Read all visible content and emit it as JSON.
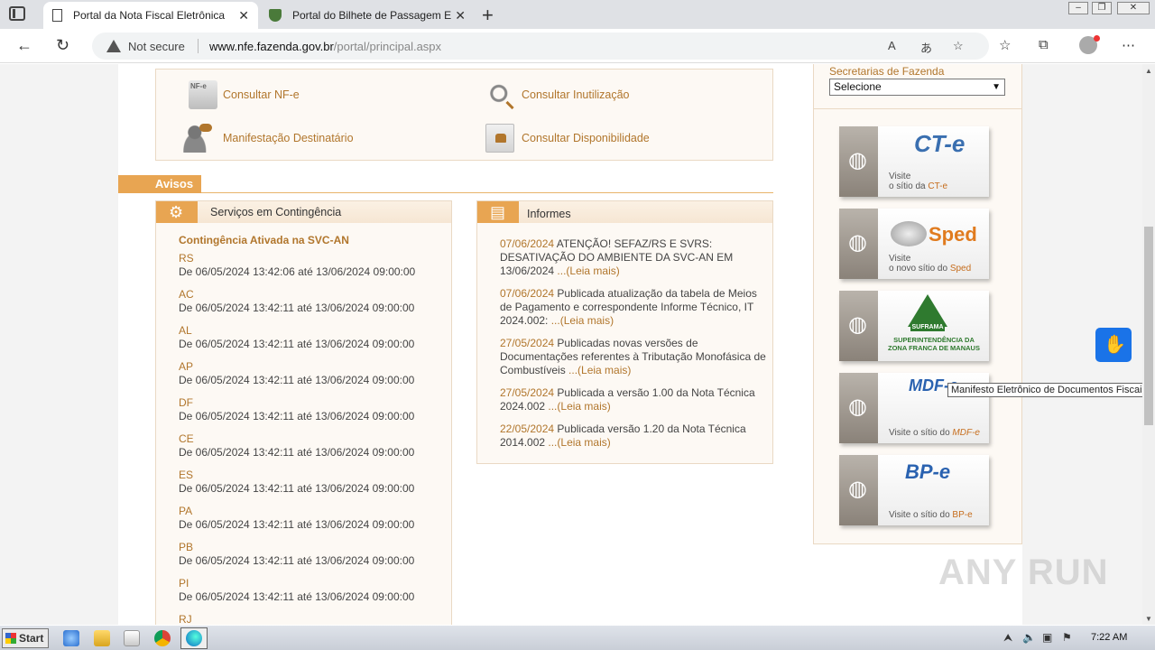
{
  "browser": {
    "tabs": [
      {
        "title": "Portal da Nota Fiscal Eletrônica",
        "active": true
      },
      {
        "title": "Portal do Bilhete de Passagem Ele",
        "active": false
      }
    ],
    "close_glyph": "✕",
    "new_tab_glyph": "+",
    "security": "Not secure",
    "url_host": "www.nfe.fazenda.gov.br",
    "url_path": "/portal/principal.aspx"
  },
  "services": {
    "consultar_nfe": "Consultar NF-e",
    "manifestacao": "Manifestação Destinatário",
    "consultar_inutilizacao": "Consultar Inutilização",
    "consultar_disponibilidade": "Consultar Disponibilidade"
  },
  "avisos": {
    "label": "Avisos"
  },
  "contingencia": {
    "panel_title": "Serviços em Contingência",
    "title": "Contingência Ativada na SVC-AN",
    "states": [
      {
        "code": "RS",
        "period": "De 06/05/2024 13:42:06 até 13/06/2024 09:00:00"
      },
      {
        "code": "AC",
        "period": "De 06/05/2024 13:42:11 até 13/06/2024 09:00:00"
      },
      {
        "code": "AL",
        "period": "De 06/05/2024 13:42:11 até 13/06/2024 09:00:00"
      },
      {
        "code": "AP",
        "period": "De 06/05/2024 13:42:11 até 13/06/2024 09:00:00"
      },
      {
        "code": "DF",
        "period": "De 06/05/2024 13:42:11 até 13/06/2024 09:00:00"
      },
      {
        "code": "CE",
        "period": "De 06/05/2024 13:42:11 até 13/06/2024 09:00:00"
      },
      {
        "code": "ES",
        "period": "De 06/05/2024 13:42:11 até 13/06/2024 09:00:00"
      },
      {
        "code": "PA",
        "period": "De 06/05/2024 13:42:11 até 13/06/2024 09:00:00"
      },
      {
        "code": "PB",
        "period": "De 06/05/2024 13:42:11 até 13/06/2024 09:00:00"
      },
      {
        "code": "PI",
        "period": "De 06/05/2024 13:42:11 até 13/06/2024 09:00:00"
      },
      {
        "code": "RJ",
        "period": ""
      }
    ]
  },
  "informes": {
    "panel_title": "Informes",
    "items": [
      {
        "date": "07/06/2024",
        "text": " ATENÇÃO! SEFAZ/RS E SVRS: DESATIVAÇÃO DO AMBIENTE DA SVC-AN EM 13/06/2024 ",
        "more": "...(Leia mais)"
      },
      {
        "date": "07/06/2024",
        "text": " Publicada atualização da tabela de Meios de Pagamento e correspondente Informe Técnico, IT 2024.002: ",
        "more": "...(Leia mais)"
      },
      {
        "date": "27/05/2024",
        "text": " Publicadas novas versões de Documentações referentes à Tributação Monofásica de Combustíveis ",
        "more": "...(Leia mais)"
      },
      {
        "date": "27/05/2024",
        "text": " Publicada a versão 1.00 da Nota Técnica 2024.002 ",
        "more": "...(Leia mais)"
      },
      {
        "date": "22/05/2024",
        "text": " Publicada versão 1.20 da Nota Técnica 2014.002 ",
        "more": "...(Leia mais)"
      }
    ]
  },
  "sidebar": {
    "secretarias_label": "Secretarias de Fazenda",
    "select_value": "Selecione",
    "banners": [
      {
        "logo": "CT-e",
        "visit": "Visite",
        "desc_prefix": "o sítio da ",
        "desc_highlight": "CT-e"
      },
      {
        "logo": "Sped",
        "visit": "Visite",
        "desc_prefix": "o novo sítio do ",
        "desc_highlight": "Sped"
      },
      {
        "logo": "SUFRAMA",
        "visit": "",
        "desc_prefix": "SUPERINTENDÊNCIA DA ZONA FRANCA DE MANAUS",
        "desc_highlight": ""
      },
      {
        "logo": "MDF-e",
        "visit": "",
        "desc_prefix": "Visite o sítio do ",
        "desc_highlight": "MDF-e"
      },
      {
        "logo": "BP-e",
        "visit": "",
        "desc_prefix": "Visite o sítio do ",
        "desc_highlight": "BP-e"
      }
    ]
  },
  "tooltip": "Manifesto Eletrônico de Documentos Fiscais",
  "watermark": "ANY RUN",
  "taskbar": {
    "start": "Start",
    "clock": "7:22 AM"
  },
  "colors": {
    "accent": "#e8a552",
    "link": "#b1762c"
  }
}
